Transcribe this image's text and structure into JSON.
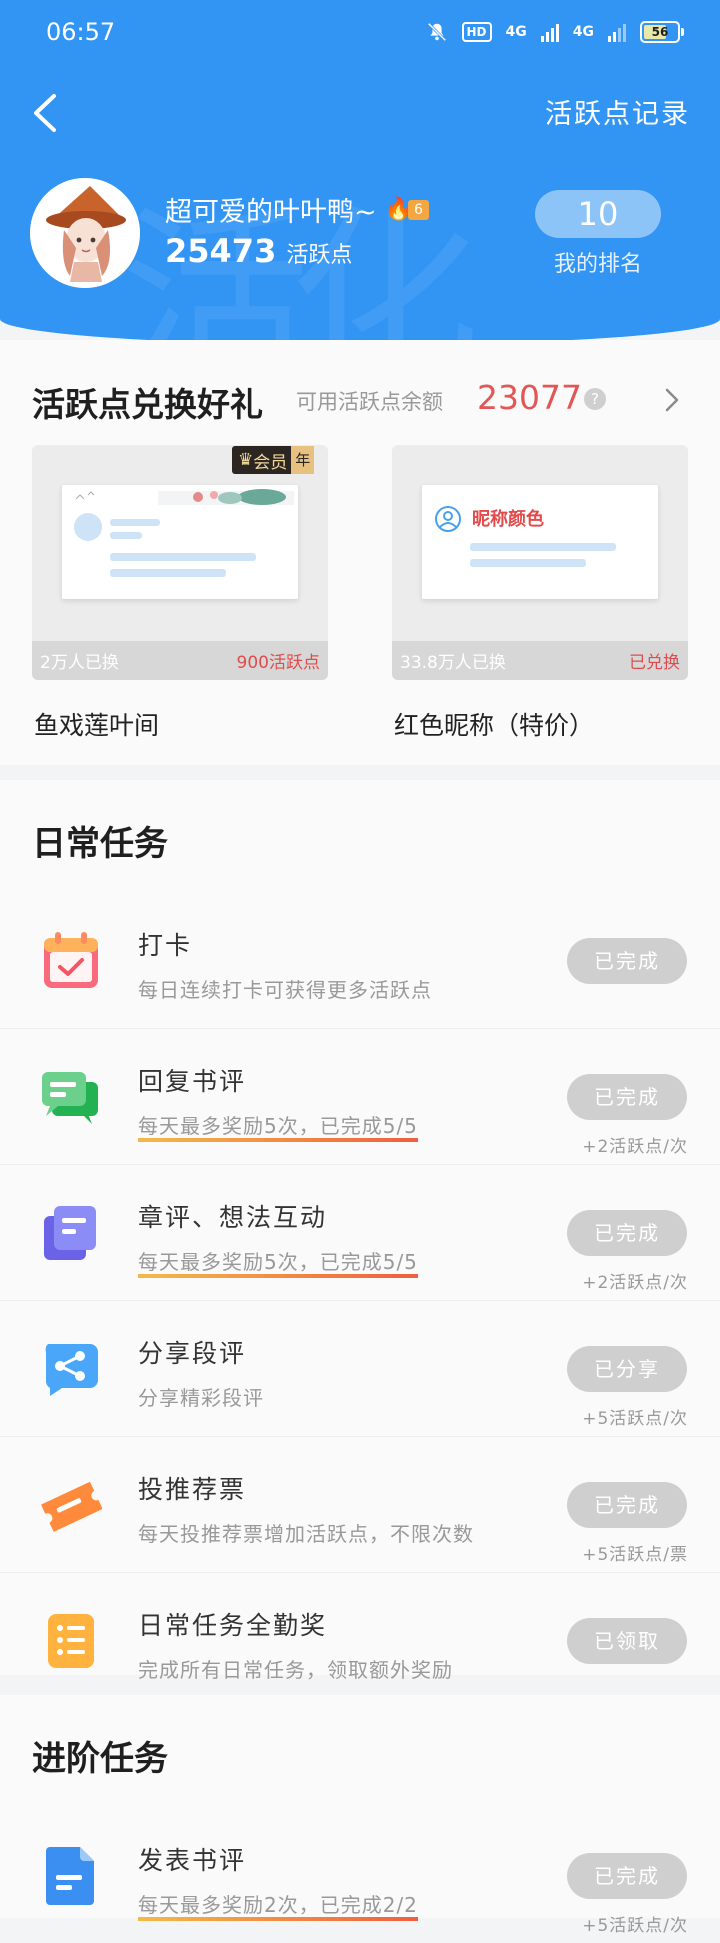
{
  "status_bar": {
    "time": "06:57",
    "hd": "HD",
    "net1": "4G",
    "net2": "4G",
    "battery": "56"
  },
  "header": {
    "record_link": "活跃点记录",
    "username": "超可爱的叶叶鸭~",
    "level": "6",
    "points": "25473",
    "points_unit": "活跃点",
    "rank": "10",
    "rank_label": "我的排名",
    "watermark": "活化"
  },
  "exchange": {
    "title": "活跃点兑换好礼",
    "available_label": "可用活跃点余额",
    "available_points": "23077",
    "help_icon": "?",
    "cards": [
      {
        "name": "鱼戏莲叶间",
        "exchanged": "2万人已换",
        "price": "900活跃点",
        "badge": "会员",
        "badge_suffix": "年"
      },
      {
        "name": "红色昵称（特价）",
        "exchanged": "33.8万人已换",
        "price": "已兑换",
        "inner_label": "昵称颜色"
      }
    ]
  },
  "daily": {
    "title": "日常任务",
    "tasks": [
      {
        "name": "打卡",
        "desc": "每日连续打卡可获得更多活跃点",
        "button": "已完成",
        "reward": "",
        "icon": "calendar-check-icon"
      },
      {
        "name": "回复书评",
        "desc": "每天最多奖励5次，已完成5/5",
        "button": "已完成",
        "reward": "+2活跃点/次",
        "icon": "chat-bubbles-icon"
      },
      {
        "name": "章评、想法互动",
        "desc": "每天最多奖励5次，已完成5/5",
        "button": "已完成",
        "reward": "+2活跃点/次",
        "icon": "cards-stack-icon"
      },
      {
        "name": "分享段评",
        "desc": "分享精彩段评",
        "button": "已分享",
        "reward": "+5活跃点/次",
        "icon": "share-icon"
      },
      {
        "name": "投推荐票",
        "desc": "每天投推荐票增加活跃点，不限次数",
        "button": "已完成",
        "reward": "+5活跃点/票",
        "icon": "ticket-icon"
      },
      {
        "name": "日常任务全勤奖",
        "desc": "完成所有日常任务，领取额外奖励",
        "button": "已领取",
        "reward": "",
        "icon": "list-icon"
      }
    ]
  },
  "advanced": {
    "title": "进阶任务",
    "tasks": [
      {
        "name": "发表书评",
        "desc": "每天最多奖励2次，已完成2/2",
        "button": "已完成",
        "reward": "+5活跃点/次",
        "icon": "document-icon"
      }
    ]
  },
  "colors": {
    "primary": "#3295f4",
    "accent_red": "#e25656",
    "done_button": "#cfcfcf"
  }
}
